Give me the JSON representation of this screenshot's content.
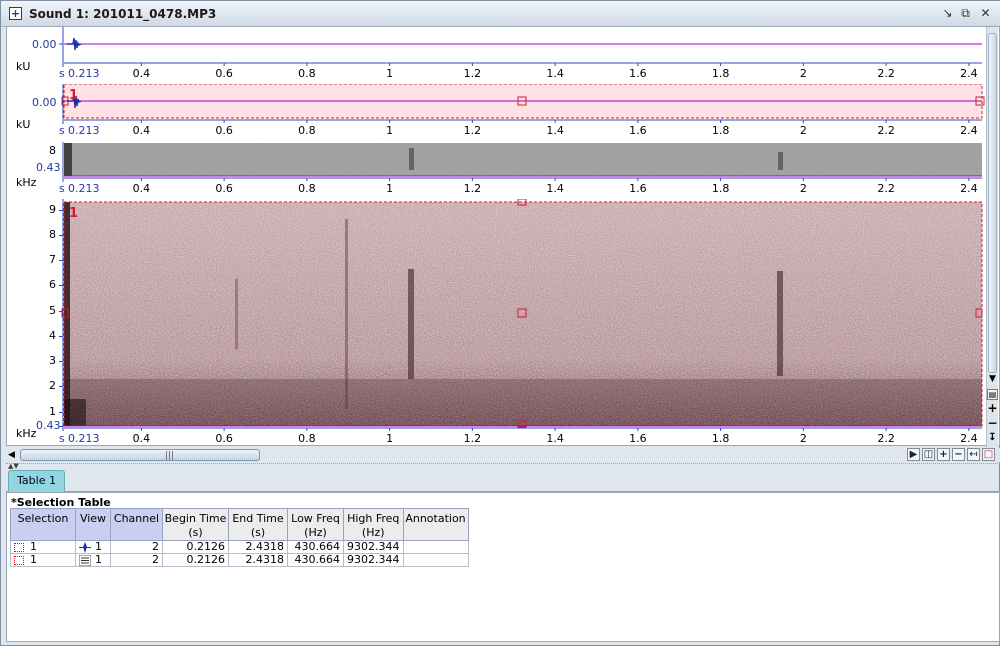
{
  "window": {
    "title": "Sound 1: 201011_0478.MP3"
  },
  "colors": {
    "waveform": "#1a2fb5",
    "axis": "#3048c0",
    "selection_fill": "#ffe1e6",
    "selection_border": "#d21c2c",
    "baseline": "#a000c0",
    "tab": "#8fd6df",
    "header": "#c8cff0"
  },
  "panels": {
    "waveform1": {
      "y_value": "0.00",
      "unit": "kU"
    },
    "waveform2": {
      "y_value": "0.00",
      "unit": "kU",
      "selection_label": "1"
    },
    "spectrogram1": {
      "y_ticks": [
        "8",
        "0.43"
      ],
      "unit": "kHz"
    },
    "spectrogram2": {
      "y_ticks": [
        "9",
        "8",
        "7",
        "6",
        "5",
        "4",
        "3",
        "2",
        "1",
        "0.43"
      ],
      "unit": "kHz",
      "selection_label": "1"
    }
  },
  "time_axis": {
    "unit": "s",
    "start": "0.213",
    "ticks": [
      "0.4",
      "0.6",
      "0.8",
      "1",
      "1.2",
      "1.4",
      "1.6",
      "1.8",
      "2",
      "2.2",
      "2.4"
    ]
  },
  "tabs": [
    {
      "label": "Table 1"
    }
  ],
  "selection_table": {
    "title": "*Selection Table",
    "columns": [
      "Selection",
      "View",
      "Channel",
      "Begin Time (s)",
      "End Time (s)",
      "Low Freq (Hz)",
      "High Freq (Hz)",
      "Annotation"
    ],
    "rows": [
      {
        "selection": "1",
        "view_icon": "waveform-view-icon",
        "view": "1",
        "channel": "2",
        "begin": "0.2126",
        "end": "2.4318",
        "low": "430.664",
        "high": "9302.344",
        "annotation": ""
      },
      {
        "selection": "1",
        "view_icon": "spectrogram-view-icon",
        "view": "1",
        "channel": "2",
        "begin": "0.2126",
        "end": "2.4318",
        "low": "430.664",
        "high": "9302.344",
        "annotation": ""
      }
    ]
  },
  "icons": {
    "title": "sound-window-icon",
    "minimize": "minimize-icon",
    "restore": "restore-icon",
    "close": "close-icon"
  }
}
